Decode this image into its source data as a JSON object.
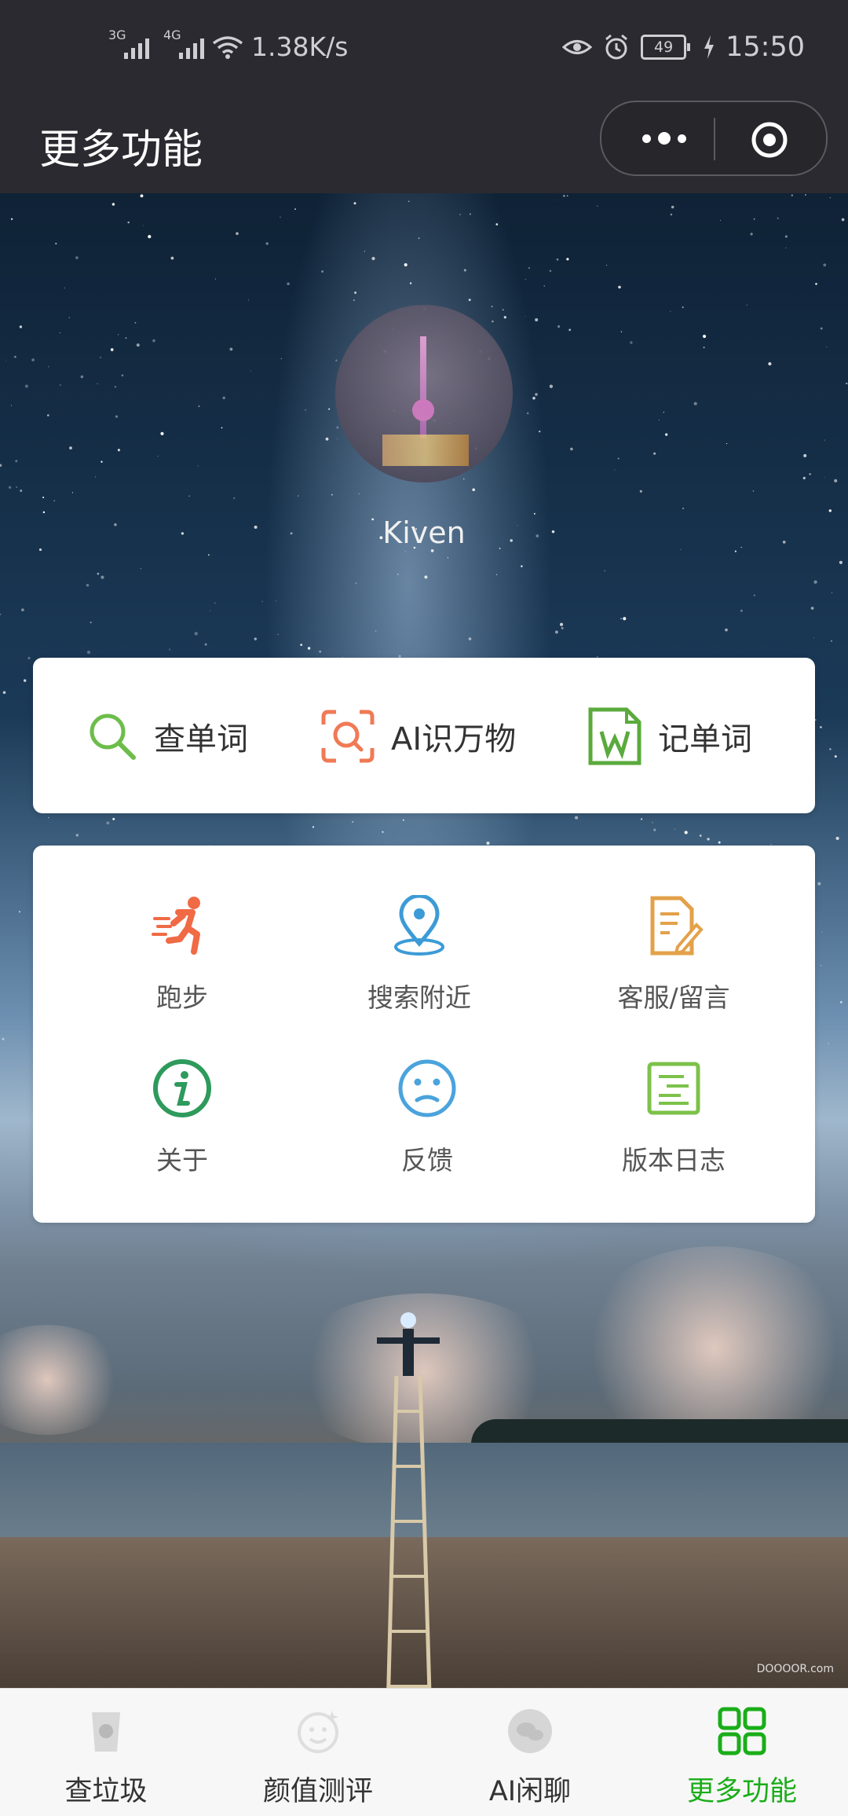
{
  "status_bar": {
    "net_3g": "3G",
    "net_4g": "4G",
    "speed": "1.38K/s",
    "battery": "49",
    "time": "15:50",
    "icons": [
      "signal-icon",
      "wifi-icon",
      "eye-icon",
      "alarm-icon",
      "battery-icon",
      "charging-icon"
    ]
  },
  "header": {
    "title": "更多功能",
    "capsule_icons": [
      "more-dots-icon",
      "close-target-icon"
    ]
  },
  "profile": {
    "name": "Kiven"
  },
  "quick_actions": [
    {
      "label": "查单词",
      "icon": "search-icon",
      "color": "#6dbd4a"
    },
    {
      "label": "AI识万物",
      "icon": "scan-icon",
      "color": "#f07a55"
    },
    {
      "label": "记单词",
      "icon": "word-doc-icon",
      "color": "#5aaa3c"
    }
  ],
  "features": [
    {
      "label": "跑步",
      "icon": "running-icon",
      "color": "#f06a45"
    },
    {
      "label": "搜索附近",
      "icon": "location-pin-icon",
      "color": "#3c9bd6"
    },
    {
      "label": "客服/留言",
      "icon": "note-edit-icon",
      "color": "#e3a14a"
    },
    {
      "label": "关于",
      "icon": "info-icon",
      "color": "#2e9a5c"
    },
    {
      "label": "反馈",
      "icon": "sad-face-icon",
      "color": "#4aa3dc"
    },
    {
      "label": "版本日志",
      "icon": "log-icon",
      "color": "#7cc24a"
    }
  ],
  "background": {
    "watermark": "DOOOOR.com"
  },
  "tabbar": {
    "tabs": [
      {
        "label": "查垃圾",
        "icon": "trash-can-icon",
        "active": false
      },
      {
        "label": "颜值测评",
        "icon": "face-icon",
        "active": false
      },
      {
        "label": "AI闲聊",
        "icon": "chat-icon",
        "active": false
      },
      {
        "label": "更多功能",
        "icon": "grid-icon",
        "active": true
      }
    ],
    "active_color": "#1aad19"
  }
}
